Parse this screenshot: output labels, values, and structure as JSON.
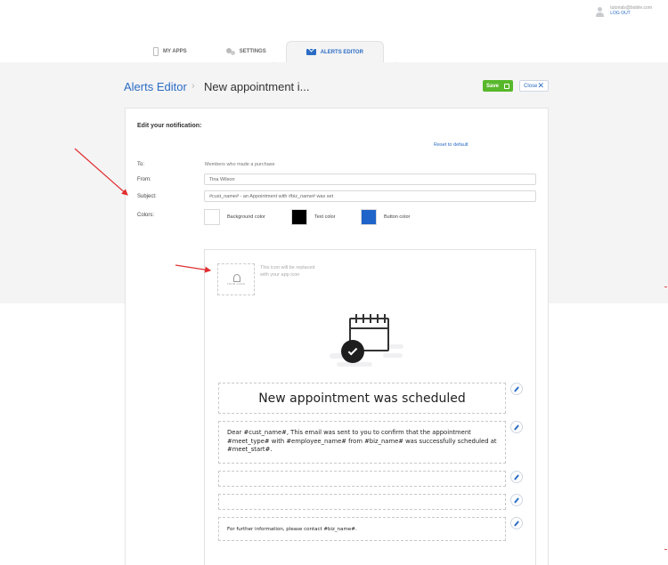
{
  "user": {
    "email": "tutorials@bobile.com",
    "logout_label": "LOG OUT"
  },
  "tabs": [
    {
      "label": "MY APPS",
      "icon": "phone-icon"
    },
    {
      "label": "SETTINGS",
      "icon": "gear-icon"
    },
    {
      "label": "ALERTS EDITOR",
      "icon": "mail-icon",
      "active": true
    }
  ],
  "header": {
    "breadcrumb": "Alerts Editor",
    "separator": "›",
    "title": "New appointment i...",
    "save_label": "Save",
    "close_label": "Close"
  },
  "form": {
    "heading": "Edit your notification:",
    "reset_label": "Reset to default",
    "to_label": "To:",
    "to_value": "Members who made a purchase",
    "from_label": "From:",
    "from_value": "Tina Wilson",
    "subject_label": "Subject:",
    "subject_value": "#cust_name# - an Appointment with #biz_name# was set",
    "colors_label": "Colors:",
    "colors": [
      {
        "label": "Background color",
        "value": "#ffffff"
      },
      {
        "label": "Text color",
        "value": "#000000"
      },
      {
        "label": "Button color",
        "value": "#1f64c8"
      }
    ]
  },
  "preview": {
    "logo_text": "YOUR LOGO",
    "icon_note_line1": "This icon will be replaced",
    "icon_note_line2": "with your app icon",
    "heading": "New appointment was scheduled",
    "body": "Dear #cust_name#, This email was sent to you to confirm that the appointment #meet_type# with #employee_name# from #biz_name# was successfully scheduled at #meet_start#.",
    "footer": "For further information, please contact #biz_name#."
  },
  "colors": {
    "accent": "#2b6cc4",
    "save": "#58b82b",
    "arrow": "#e03030"
  }
}
